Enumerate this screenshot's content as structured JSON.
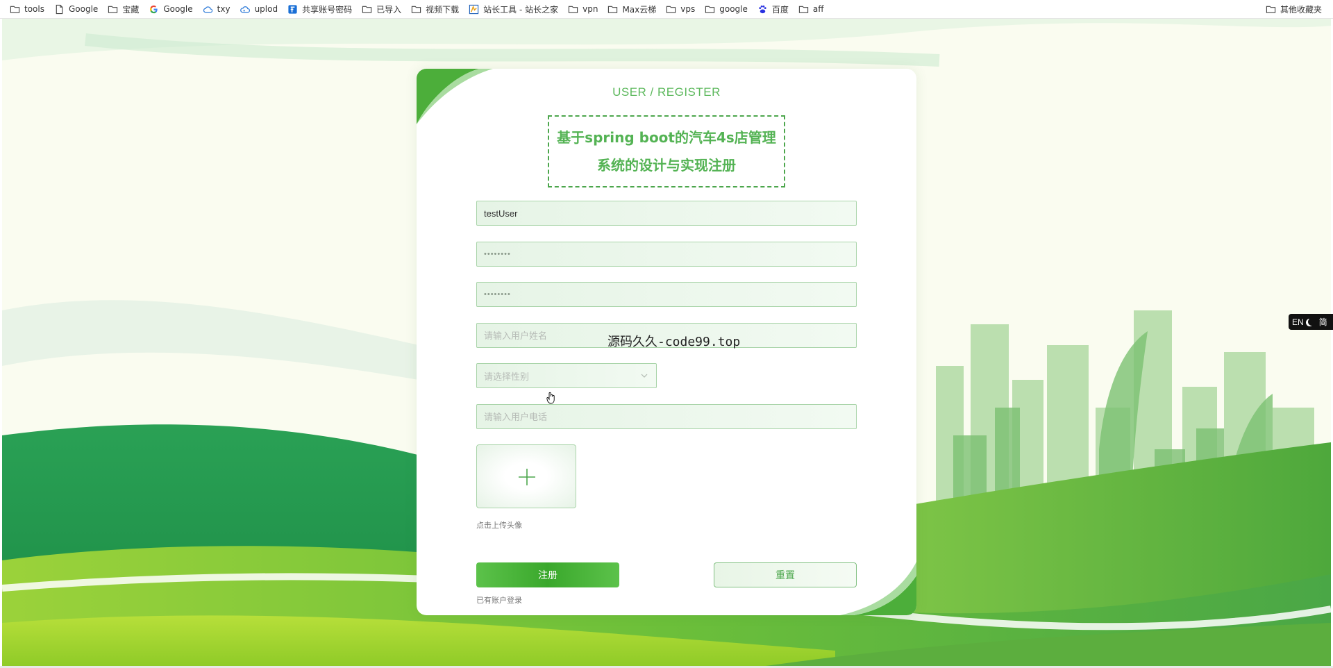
{
  "bookmarks": {
    "items": [
      {
        "label": "tools",
        "icon": "folder-icon"
      },
      {
        "label": "Google",
        "icon": "page-icon"
      },
      {
        "label": "宝藏",
        "icon": "folder-icon"
      },
      {
        "label": "Google",
        "icon": "google-icon"
      },
      {
        "label": "txy",
        "icon": "cloud-icon"
      },
      {
        "label": "uplod",
        "icon": "cloud-icon"
      },
      {
        "label": "共享账号密码",
        "icon": "app-icon"
      },
      {
        "label": "已导入",
        "icon": "folder-icon"
      },
      {
        "label": "视频下载",
        "icon": "folder-icon"
      },
      {
        "label": "站长工具 - 站长之家",
        "icon": "chinaz-icon"
      },
      {
        "label": "vpn",
        "icon": "folder-icon"
      },
      {
        "label": "Max云梯",
        "icon": "folder-icon"
      },
      {
        "label": "vps",
        "icon": "folder-icon"
      },
      {
        "label": "google",
        "icon": "folder-icon"
      },
      {
        "label": "百度",
        "icon": "baidu-icon"
      },
      {
        "label": "aff",
        "icon": "folder-icon"
      }
    ],
    "other": "其他收藏夹"
  },
  "card": {
    "title_en": "USER / REGISTER",
    "title_cn": "基于spring boot的汽车4s店管理系统的设计与实现注册",
    "fields": {
      "username_value": "testUser",
      "password_value": "••••••••",
      "confirm_value": "••••••••",
      "name_placeholder": "请输入用户姓名",
      "gender_placeholder": "请选择性别",
      "phone_placeholder": "请输入用户电话"
    },
    "upload_tip": "点击上传头像",
    "register_label": "注册",
    "reset_label": "重置",
    "login_link": "已有账户登录"
  },
  "watermark": "源码久久-code99.top",
  "lang_toggle": {
    "left": "EN",
    "right": "简"
  },
  "colors": {
    "accent": "#54b354",
    "button": "#3aa82c",
    "border": "#a9d4a9"
  }
}
